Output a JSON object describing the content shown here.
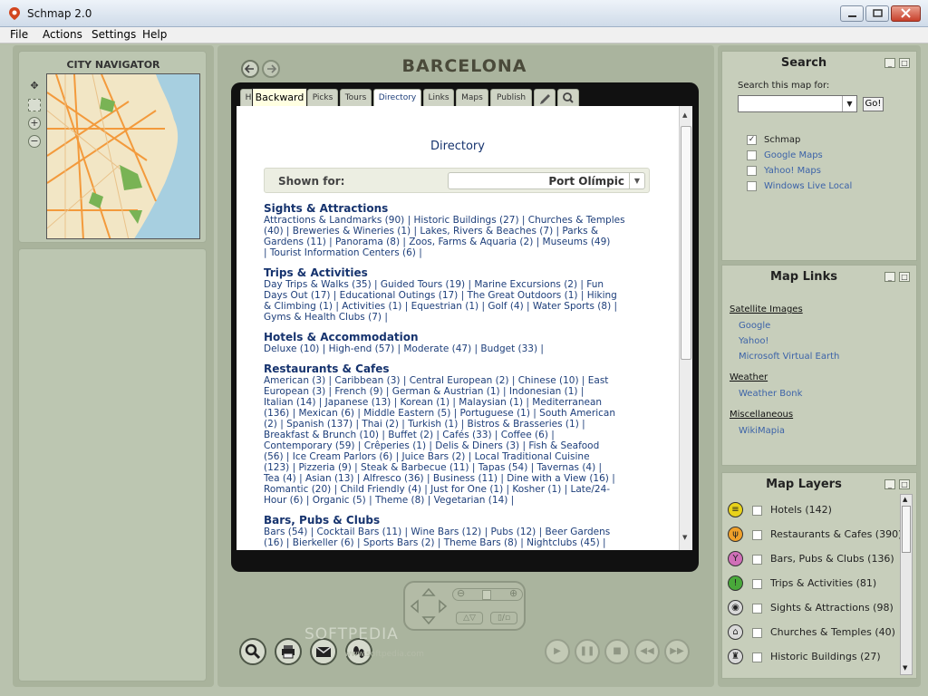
{
  "window": {
    "title": "Schmap 2.0"
  },
  "menu": [
    "File",
    "Actions",
    "Settings",
    "Help"
  ],
  "navigator": {
    "title": "CITY NAVIGATOR"
  },
  "city": "BARCELONA",
  "tabs": [
    {
      "label": "H"
    },
    {
      "label": "Picks"
    },
    {
      "label": "Tours"
    },
    {
      "label": "Directory"
    },
    {
      "label": "Links"
    },
    {
      "label": "Maps"
    },
    {
      "label": "Publish"
    }
  ],
  "tooltip": "Backward",
  "directory": {
    "title": "Directory",
    "shown_for_label": "Shown for:",
    "shown_for_value": "Port Olímpic",
    "sections": [
      {
        "heading": "Sights & Attractions",
        "lines": [
          "Attractions & Landmarks (90) | Historic Buildings (27) | Churches & Temples",
          "(40) | Breweries & Wineries (1) | Lakes, Rivers & Beaches (7) | Parks &",
          "Gardens (11) | Panorama (8) | Zoos, Farms & Aquaria (2) | Museums (49)",
          "| Tourist Information Centers (6) |"
        ]
      },
      {
        "heading": "Trips & Activities",
        "lines": [
          "Day Trips & Walks (35) | Guided Tours (19) | Marine Excursions (2) | Fun",
          "Days Out (17) | Educational Outings (17) | The Great Outdoors (1) | Hiking",
          "& Climbing (1) | Activities (1) | Equestrian (1) | Golf (4) | Water Sports (8) |",
          "Gyms & Health Clubs (7) |"
        ]
      },
      {
        "heading": "Hotels & Accommodation",
        "lines": [
          "Deluxe (10) | High-end (57) | Moderate (47) | Budget (33) |"
        ]
      },
      {
        "heading": "Restaurants & Cafes",
        "lines": [
          "American (3) | Caribbean (3) | Central European (2) | Chinese (10) | East",
          "European (3) | French (9) | German & Austrian (1) | Indonesian (1) |",
          "Italian (14) | Japanese (13) | Korean (1) | Malaysian (1) | Mediterranean",
          "(136) | Mexican (6) | Middle Eastern (5) | Portuguese (1) | South American",
          "(2) | Spanish (137) | Thai (2) | Turkish (1) | Bistros & Brasseries (1) |",
          "Breakfast & Brunch (10) | Buffet (2) | Cafés (33) | Coffee (6) |",
          "Contemporary (59) | Crêperies (1) | Delis & Diners (3) | Fish & Seafood",
          "(56) | Ice Cream Parlors (6) | Juice Bars (2) | Local Traditional Cuisine",
          "(123) | Pizzeria (9) | Steak & Barbecue (11) | Tapas (54) | Tavernas (4) |",
          "Tea (4) | Asian (13) | Alfresco (36) | Business (11) | Dine with a View (16) |",
          "Romantic (20) | Child Friendly (4) | Just for One (1) | Kosher (1) | Late/24-",
          "Hour (6) | Organic (5) | Theme (8) | Vegetarian (14) |"
        ]
      },
      {
        "heading": "Bars, Pubs & Clubs",
        "lines": [
          "Bars (54) | Cocktail Bars (11) | Wine Bars (12) | Pubs (12) | Beer Gardens",
          "(16) | Bierkeller (6) | Sports Bars (2) | Theme Bars (8) | Nightclubs (45) |"
        ]
      }
    ]
  },
  "watermark": {
    "main": "SOFTPEDIA",
    "sub": "www.softpedia.com"
  },
  "search": {
    "title": "Search",
    "label": "Search this map for:",
    "input_value": "",
    "go_label": "Go!",
    "sources": [
      {
        "label": "Schmap",
        "checked": true
      },
      {
        "label": "Google Maps",
        "checked": false
      },
      {
        "label": "Yahoo! Maps",
        "checked": false
      },
      {
        "label": "Windows Live Local",
        "checked": false
      }
    ]
  },
  "map_links": {
    "title": "Map Links",
    "groups": [
      {
        "heading": "Satellite Images",
        "links": [
          "Google",
          "Yahoo!",
          "Microsoft Virtual Earth"
        ]
      },
      {
        "heading": "Weather",
        "links": [
          "Weather Bonk"
        ]
      },
      {
        "heading": "Miscellaneous",
        "links": [
          "WikiMapia"
        ]
      }
    ]
  },
  "map_layers": {
    "title": "Map Layers",
    "items": [
      {
        "label": "Hotels (142)",
        "icon": "bed-icon",
        "color": "#e8d21a"
      },
      {
        "label": "Restaurants & Cafes (390)",
        "icon": "fork-knife-icon",
        "color": "#f0a02a"
      },
      {
        "label": "Bars, Pubs & Clubs (136)",
        "icon": "glass-icon",
        "color": "#d06fb8"
      },
      {
        "label": "Trips & Activities (81)",
        "icon": "activity-icon",
        "color": "#49a83a"
      },
      {
        "label": "Sights & Attractions (98)",
        "icon": "camera-icon",
        "color": "#d9d9d9"
      },
      {
        "label": "Churches & Temples (40)",
        "icon": "church-icon",
        "color": "#d9d9d9"
      },
      {
        "label": "Historic Buildings (27)",
        "icon": "building-icon",
        "color": "#d9d9d9"
      }
    ]
  }
}
